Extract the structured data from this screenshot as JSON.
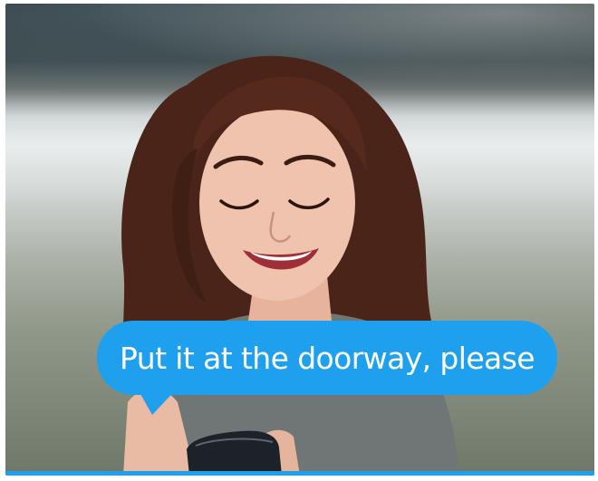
{
  "speech_bubble": {
    "text": "Put it at the doorway, please"
  },
  "colors": {
    "bubble": "#1ea0ee",
    "bubble_text": "#ffffff",
    "hair": "#4a2419",
    "skin": "#efc3ad",
    "top": "#707575"
  }
}
